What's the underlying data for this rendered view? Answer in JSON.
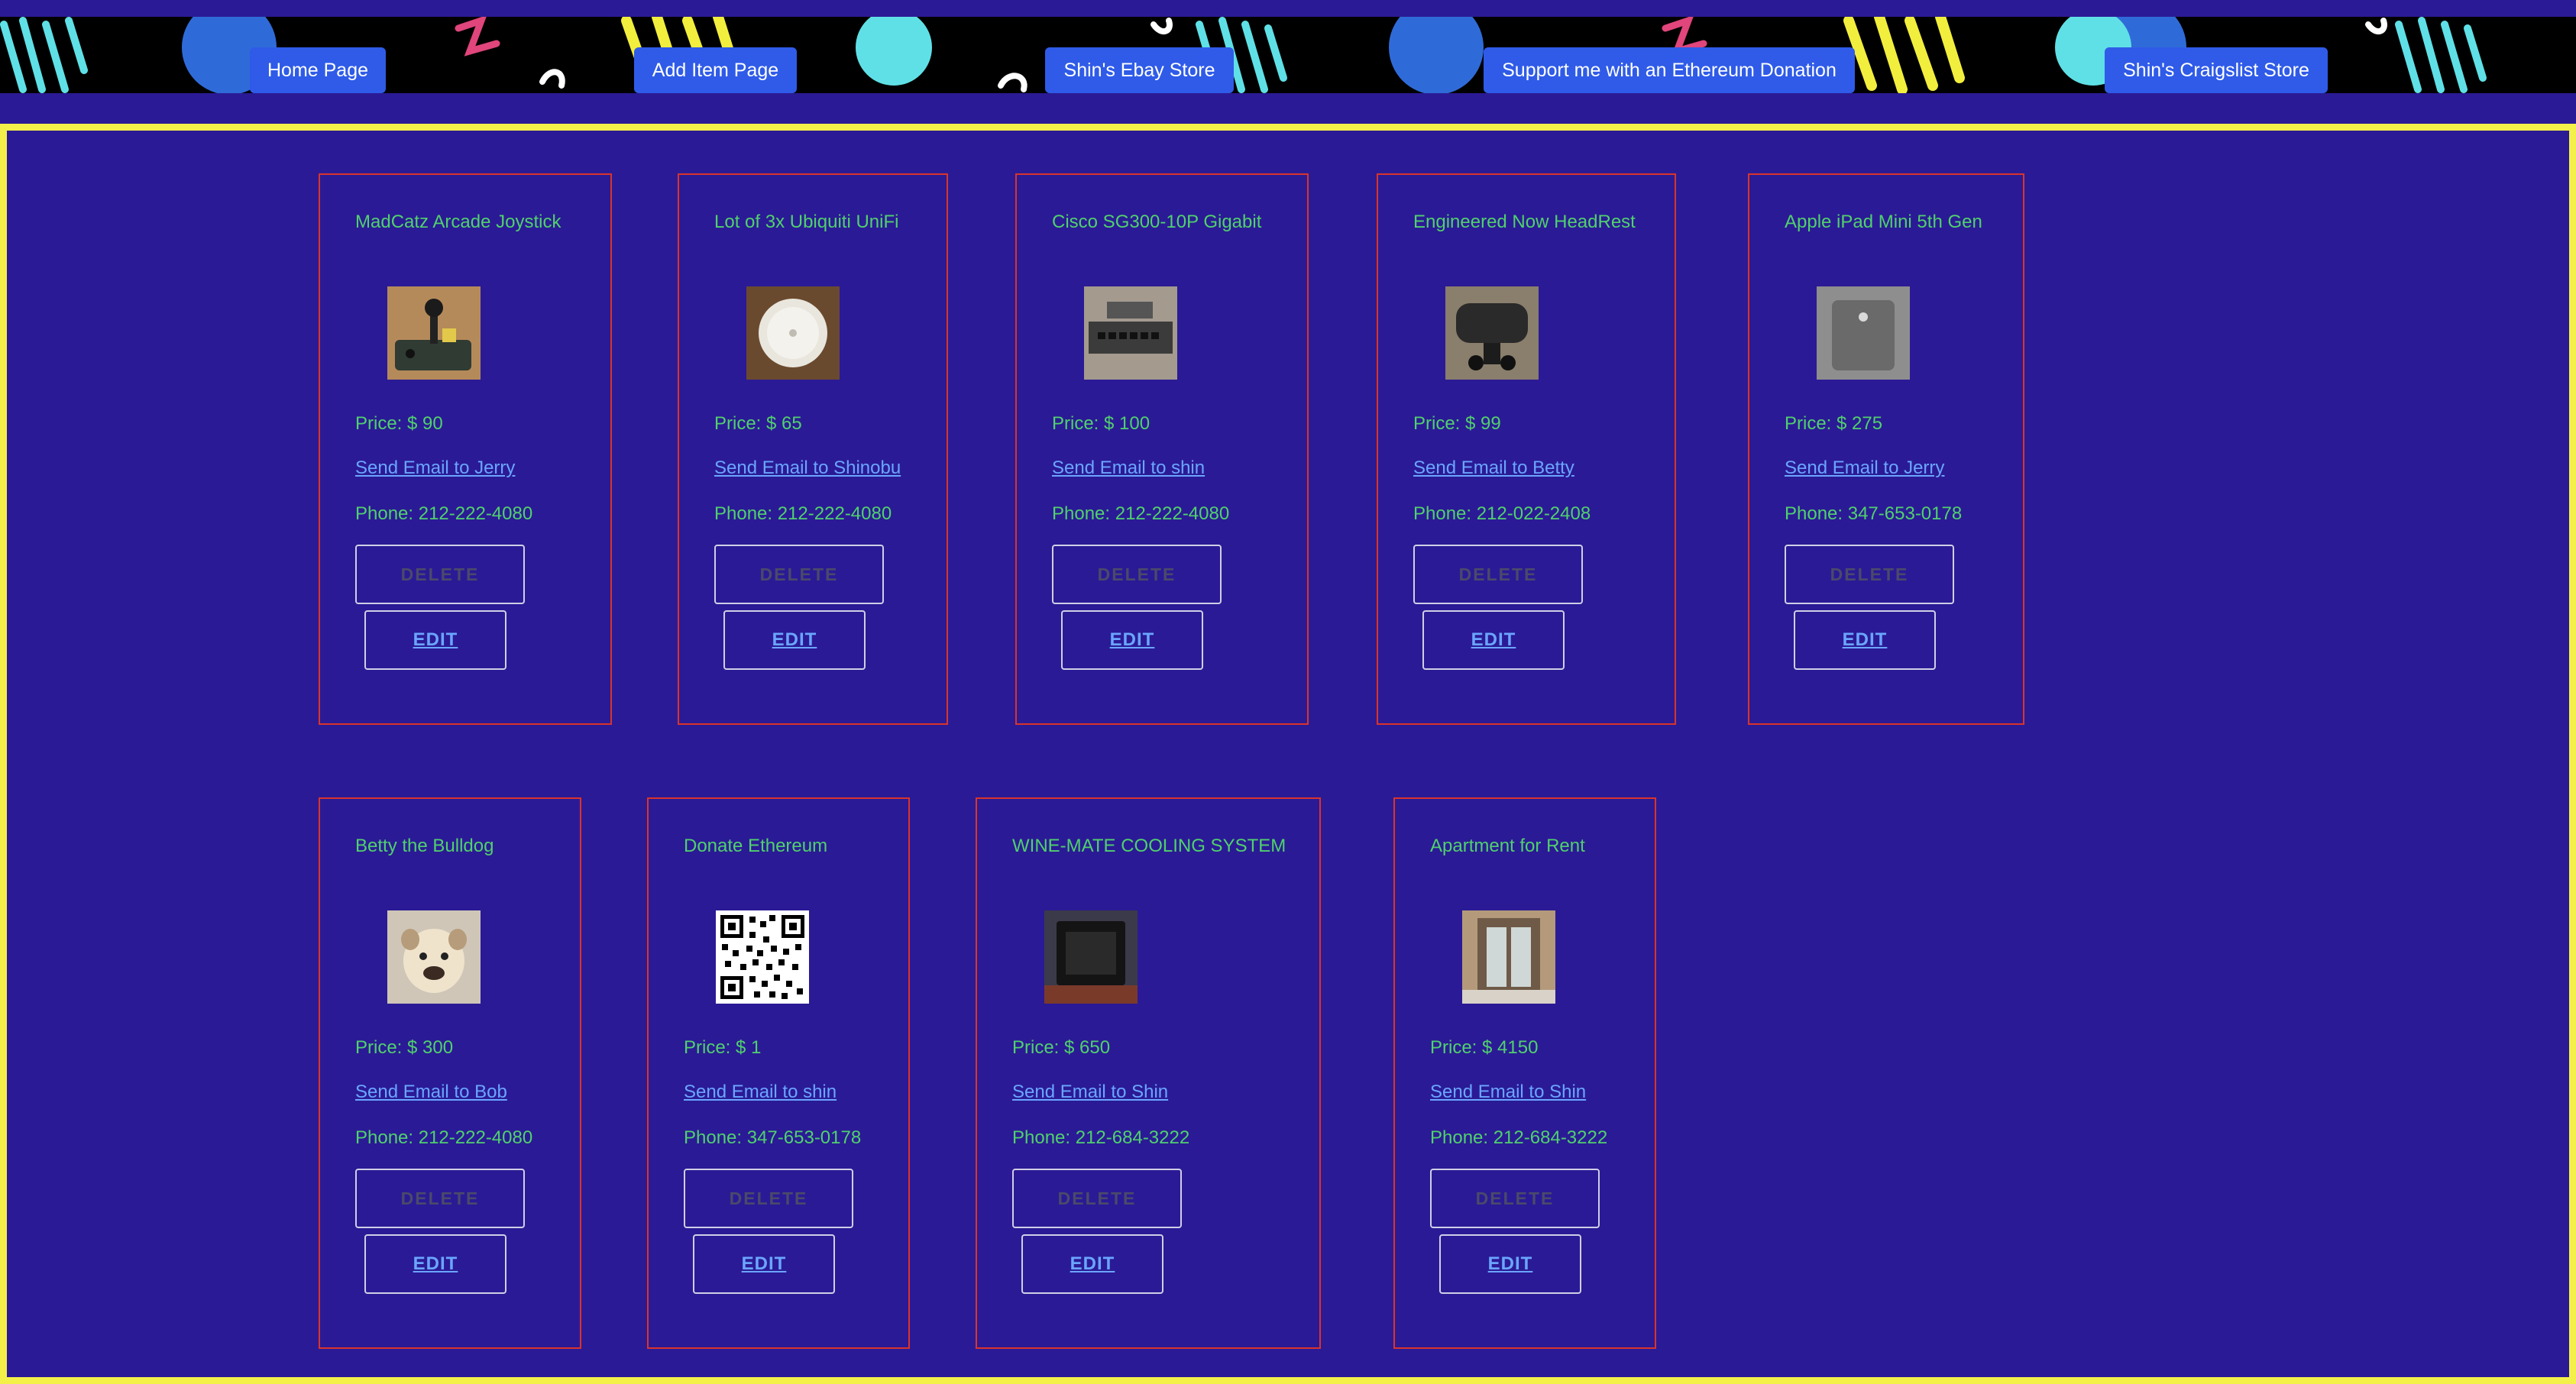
{
  "nav": {
    "home": "Home Page",
    "add_item": "Add Item Page",
    "ebay": "Shin's Ebay Store",
    "donation": "Support me with an Ethereum Donation",
    "craigslist": "Shin's Craigslist Store"
  },
  "card_labels": {
    "delete": "DELETE",
    "edit": "EDIT"
  },
  "colors": {
    "background": "#2b1a95",
    "frame_border": "#f3f04a",
    "card_border": "#d9342b",
    "text_green": "#4fd16d",
    "link_blue": "#6aa6ff",
    "nav_button": "#2f5be8"
  },
  "items": [
    {
      "title": "MadCatz Arcade Joystick",
      "image": "joystick-photo",
      "price": "Price: $ 90",
      "email": "Send Email to Jerry",
      "phone": "Phone: 212-222-4080"
    },
    {
      "title": "Lot of 3x Ubiquiti UniFi",
      "image": "wifi-access-point-photo",
      "price": "Price: $ 65",
      "email": "Send Email to Shinobu",
      "phone": "Phone: 212-222-4080"
    },
    {
      "title": "Cisco SG300-10P Gigabit",
      "image": "network-switch-photo",
      "price": "Price: $ 100",
      "email": "Send Email to shin",
      "phone": "Phone: 212-222-4080"
    },
    {
      "title": "Engineered Now HeadRest",
      "image": "headrest-photo",
      "price": "Price: $ 99",
      "email": "Send Email to Betty",
      "phone": "Phone: 212-022-2408"
    },
    {
      "title": "Apple iPad Mini 5th Gen",
      "image": "ipad-photo",
      "price": "Price: $ 275",
      "email": "Send Email to Jerry",
      "phone": "Phone: 347-653-0178"
    },
    {
      "title": "Betty the Bulldog",
      "image": "bulldog-photo",
      "price": "Price: $ 300",
      "email": "Send Email to Bob",
      "phone": "Phone: 212-222-4080"
    },
    {
      "title": "Donate Ethereum",
      "image": "qr-code",
      "price": "Price: $ 1",
      "email": "Send Email to shin",
      "phone": "Phone: 347-653-0178"
    },
    {
      "title": "WINE-MATE COOLING SYSTEM",
      "image": "wine-cooler-photo",
      "price": "Price: $ 650",
      "email": "Send Email to Shin",
      "phone": "Phone: 212-684-3222"
    },
    {
      "title": "Apartment for Rent",
      "image": "apartment-lobby-photo",
      "price": "Price: $ 4150",
      "email": "Send Email to Shin",
      "phone": "Phone: 212-684-3222"
    }
  ]
}
